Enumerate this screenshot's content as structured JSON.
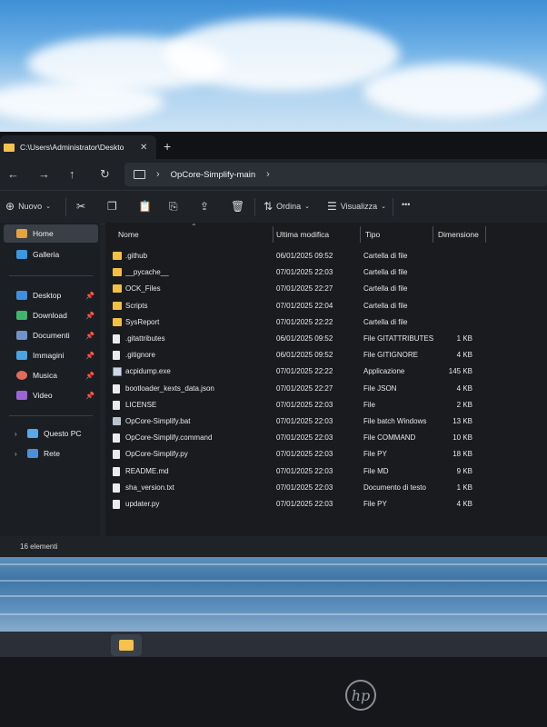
{
  "window": {
    "tab_title": "C:\\Users\\Administrator\\Deskto",
    "close_tab": "✕",
    "new_tab": "+"
  },
  "nav": {
    "back": "←",
    "forward": "→",
    "up": "↑",
    "refresh": "↻",
    "breadcrumb_chevron": "›",
    "breadcrumb": "OpCore-Simplify-main",
    "breadcrumb_more": "›"
  },
  "toolbar": {
    "new_label": "Nuovo",
    "sort_label": "Ordina",
    "view_label": "Visualizza",
    "more": "•••"
  },
  "sidebar": {
    "home": "Home",
    "gallery": "Galleria",
    "quick": [
      {
        "label": "Desktop",
        "color": "#3f8fe0"
      },
      {
        "label": "Download",
        "color": "#3fb56b"
      },
      {
        "label": "Documenti",
        "color": "#6f93c9"
      },
      {
        "label": "Immagini",
        "color": "#4aa3e2"
      },
      {
        "label": "Musica",
        "color": "#e26c5a"
      },
      {
        "label": "Video",
        "color": "#9b63d6"
      }
    ],
    "this_pc": "Questo PC",
    "network": "Rete"
  },
  "columns": {
    "name": "Nome",
    "modified": "Ultima modifica",
    "type": "Tipo",
    "size": "Dimensione"
  },
  "files": [
    {
      "icon": "folder",
      "name": ".github",
      "date": "06/01/2025 09:52",
      "type": "Cartella di file",
      "size": ""
    },
    {
      "icon": "folder",
      "name": "__pycache__",
      "date": "07/01/2025 22:03",
      "type": "Cartella di file",
      "size": ""
    },
    {
      "icon": "folder",
      "name": "OCK_Files",
      "date": "07/01/2025 22:27",
      "type": "Cartella di file",
      "size": ""
    },
    {
      "icon": "folder",
      "name": "Scripts",
      "date": "07/01/2025 22:04",
      "type": "Cartella di file",
      "size": ""
    },
    {
      "icon": "folder",
      "name": "SysReport",
      "date": "07/01/2025 22:22",
      "type": "Cartella di file",
      "size": ""
    },
    {
      "icon": "file",
      "name": ".gitattributes",
      "date": "06/01/2025 09:52",
      "type": "File GITATTRIBUTES",
      "size": "1 KB"
    },
    {
      "icon": "file",
      "name": ".gitignore",
      "date": "06/01/2025 09:52",
      "type": "File GITIGNORE",
      "size": "4 KB"
    },
    {
      "icon": "app",
      "name": "acpidump.exe",
      "date": "07/01/2025 22:22",
      "type": "Applicazione",
      "size": "145 KB"
    },
    {
      "icon": "file",
      "name": "bootloader_kexts_data.json",
      "date": "07/01/2025 22:27",
      "type": "File JSON",
      "size": "4 KB"
    },
    {
      "icon": "file",
      "name": "LICENSE",
      "date": "07/01/2025 22:03",
      "type": "File",
      "size": "2 KB"
    },
    {
      "icon": "bat",
      "name": "OpCore-Simplify.bat",
      "date": "07/01/2025 22:03",
      "type": "File batch Windows",
      "size": "13 KB"
    },
    {
      "icon": "file",
      "name": "OpCore-Simplify.command",
      "date": "07/01/2025 22:03",
      "type": "File COMMAND",
      "size": "10 KB"
    },
    {
      "icon": "file",
      "name": "OpCore-Simplify.py",
      "date": "07/01/2025 22:03",
      "type": "File PY",
      "size": "18 KB"
    },
    {
      "icon": "file",
      "name": "README.md",
      "date": "07/01/2025 22:03",
      "type": "File MD",
      "size": "9 KB"
    },
    {
      "icon": "file",
      "name": "sha_version.txt",
      "date": "07/01/2025 22:03",
      "type": "Documento di testo",
      "size": "1 KB"
    },
    {
      "icon": "file",
      "name": "updater.py",
      "date": "07/01/2025 22:03",
      "type": "File PY",
      "size": "4 KB"
    }
  ],
  "status": {
    "count": "16 elementi"
  },
  "brand": {
    "logo": "hp"
  }
}
